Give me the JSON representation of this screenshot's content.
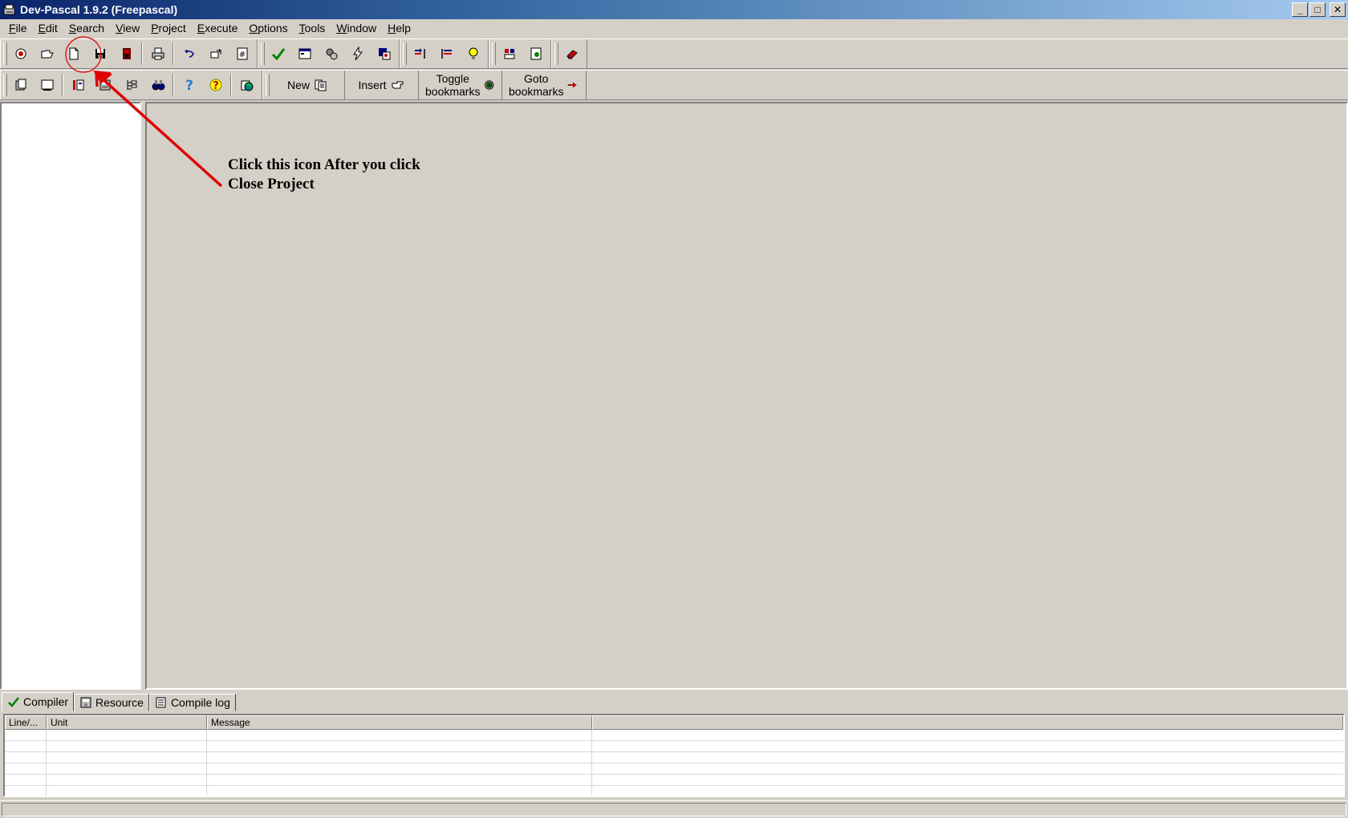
{
  "window": {
    "title": "Dev-Pascal 1.9.2 (Freepascal)",
    "controls": {
      "minimize": "_",
      "maximize": "□",
      "close": "✕"
    }
  },
  "menu": [
    {
      "label": "File",
      "u": "F",
      "rest": "ile"
    },
    {
      "label": "Edit",
      "u": "E",
      "rest": "dit"
    },
    {
      "label": "Search",
      "u": "S",
      "rest": "earch"
    },
    {
      "label": "View",
      "u": "V",
      "rest": "iew"
    },
    {
      "label": "Project",
      "u": "P",
      "rest": "roject"
    },
    {
      "label": "Execute",
      "u": "E",
      "rest": "xecute"
    },
    {
      "label": "Options",
      "u": "O",
      "rest": "ptions"
    },
    {
      "label": "Tools",
      "u": "T",
      "rest": "ools"
    },
    {
      "label": "Window",
      "u": "W",
      "rest": "indow"
    },
    {
      "label": "Help",
      "u": "H",
      "rest": "elp"
    }
  ],
  "toolbar2": {
    "new_label": "New",
    "insert_label": "Insert",
    "toggle_line1": "Toggle",
    "toggle_line2": "bookmarks",
    "goto_line1": "Goto",
    "goto_line2": "bookmarks"
  },
  "annotation": {
    "line1": "Click this icon After you click",
    "line2": "Close Project",
    "color": "#e00000"
  },
  "tabs": [
    {
      "label": "Compiler",
      "icon": "check-icon"
    },
    {
      "label": "Resource",
      "icon": "resource-icon"
    },
    {
      "label": "Compile log",
      "icon": "log-icon"
    }
  ],
  "messages": {
    "columns": [
      "Line/...",
      "Unit",
      "Message",
      ""
    ]
  }
}
